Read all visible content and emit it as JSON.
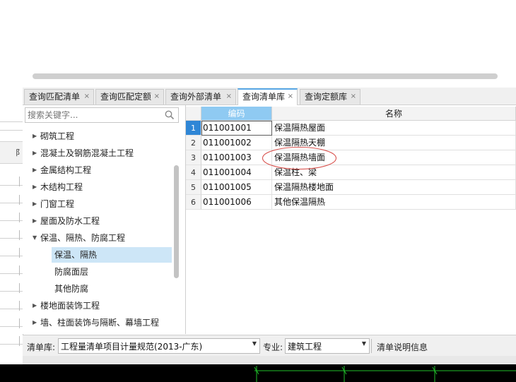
{
  "colors": {
    "accent": "#2f86d6",
    "header_highlight": "#8fcaf2",
    "selection": "#cde6f7",
    "annotation": "#d9534f",
    "cad_line": "#1fbf2a"
  },
  "left_strip": {
    "header_text": "阝"
  },
  "tabs": [
    {
      "label": "查询匹配清单",
      "close": "×"
    },
    {
      "label": "查询匹配定额",
      "close": "×"
    },
    {
      "label": "查询外部清单",
      "close": "×"
    },
    {
      "label": "查询清单库",
      "close": "×",
      "active": true
    },
    {
      "label": "查询定额库",
      "close": "×"
    }
  ],
  "search": {
    "placeholder": "搜索关键字...",
    "icon": "search-icon"
  },
  "tree": {
    "items": [
      {
        "label": "砌筑工程",
        "expanded": false
      },
      {
        "label": "混凝土及钢筋混凝土工程",
        "expanded": false
      },
      {
        "label": "金属结构工程",
        "expanded": false
      },
      {
        "label": "木结构工程",
        "expanded": false
      },
      {
        "label": "门窗工程",
        "expanded": false
      },
      {
        "label": "屋面及防水工程",
        "expanded": false
      },
      {
        "label": "保温、隔热、防腐工程",
        "expanded": true
      },
      {
        "label": "保温、隔热",
        "child": true,
        "selected": true
      },
      {
        "label": "防腐面层",
        "child": true
      },
      {
        "label": "其他防腐",
        "child": true
      },
      {
        "label": "楼地面装饰工程",
        "expanded": false
      },
      {
        "label": "墙、柱面装饰与隔断、幕墙工程",
        "expanded": false
      }
    ]
  },
  "grid": {
    "columns": {
      "code": "编码",
      "name": "名称"
    },
    "rows": [
      {
        "num": "1",
        "code": "011001001",
        "name": "保温隔热屋面"
      },
      {
        "num": "2",
        "code": "011001002",
        "name": "保温隔热天棚"
      },
      {
        "num": "3",
        "code": "011001003",
        "name": "保温隔热墙面"
      },
      {
        "num": "4",
        "code": "011001004",
        "name": "保温柱、梁"
      },
      {
        "num": "5",
        "code": "011001005",
        "name": "保温隔热楼地面"
      },
      {
        "num": "6",
        "code": "011001006",
        "name": "其他保温隔热"
      }
    ]
  },
  "bottom_bar": {
    "library_label": "清单库:",
    "library_value": "工程量清单项目计量规范(2013-广东)",
    "specialty_label": "专业:",
    "specialty_value": "建筑工程",
    "info_button": "清单说明信息"
  }
}
